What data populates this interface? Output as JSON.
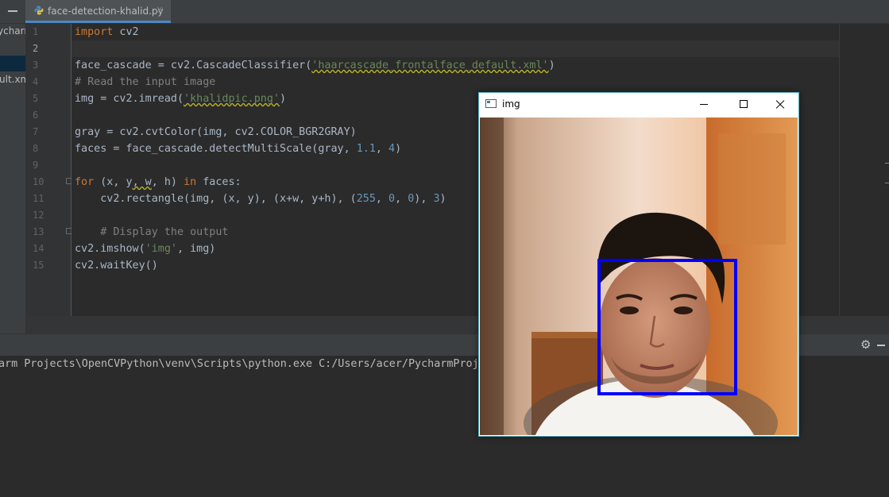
{
  "editor_tab": {
    "filename": "face-detection-khalid.py",
    "close_glyph": "×"
  },
  "sidebar": {
    "project_name_fragment": "ycharm",
    "file_fragment": "ult.xml"
  },
  "gutter": {
    "line_numbers": [
      "1",
      "2",
      "3",
      "4",
      "5",
      "6",
      "7",
      "8",
      "9",
      "10",
      "11",
      "12",
      "13",
      "14",
      "15"
    ]
  },
  "code": {
    "l1_kw": "import",
    "l1_rest": " cv2",
    "l3_a": "face_cascade = cv2.CascadeClassifier(",
    "l3_str": "'haarcascade_frontalface_default.xml'",
    "l3_b": ")",
    "l4": "# Read the input image",
    "l5_a": "img = cv2.imread(",
    "l5_str": "'khalidpic.png'",
    "l5_b": ")",
    "l7": "gray = cv2.cvtColor(img, cv2.COLOR_BGR2GRAY)",
    "l8_a": "faces = face_cascade.detectMultiScale(gray, ",
    "l8_n1": "1.1",
    "l8_c": ", ",
    "l8_n2": "4",
    "l8_b": ")",
    "l10_kw1": "for",
    "l10_a": " (x, y",
    "l10_b": ", w",
    "l10_c": ", h) ",
    "l10_kw2": "in",
    "l10_d": " faces:",
    "l11_a": "    cv2.rectangle(img, (x",
    "l11_b": ", y), (x+w, y+h), (",
    "l11_n1": "255",
    "l11_c": ", ",
    "l11_n2": "0",
    "l11_d": ", ",
    "l11_n3": "0",
    "l11_e": "), ",
    "l11_n4": "3",
    "l11_f": ")",
    "l13": "    # Display the output",
    "l14_a": "cv2.imshow(",
    "l14_str": "'img'",
    "l14_b": ", img)",
    "l15": "cv2.waitKey()"
  },
  "run_panel": {
    "console_line": "arm Projects\\OpenCVPython\\venv\\Scripts\\python.exe C:/Users/acer/PycharmProjects"
  },
  "cv_window": {
    "title": "img"
  },
  "colors": {
    "keyword": "#cc7832",
    "string": "#6a8759",
    "number": "#6897bb",
    "comment": "#808080",
    "detection_box": "#0000ff"
  },
  "icons": [
    "python-file-icon",
    "settings-gear-icon",
    "minimize-icon",
    "maximize-icon",
    "close-icon",
    "opencv-window-icon"
  ]
}
